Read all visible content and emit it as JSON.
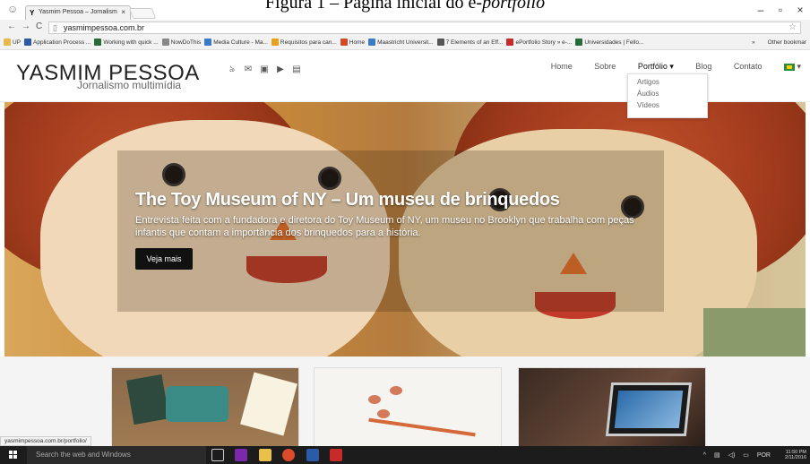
{
  "caption": {
    "text": "Figura 1 – Página inicial do e-",
    "italic": "portfolio"
  },
  "browser": {
    "tab_title": "Yasmim Pessoa – Jornalism",
    "tab_favicon": "Y",
    "url": "yasmimpessoa.com.br",
    "bookmarks": [
      {
        "label": "UP",
        "color": "#e8b84a"
      },
      {
        "label": "Application Process ...",
        "color": "#2a5aa8"
      },
      {
        "label": "Working with quick ...",
        "color": "#2a6a3a"
      },
      {
        "label": "NowDoThis",
        "color": "#888888"
      },
      {
        "label": "Media Culture - Ma...",
        "color": "#3a7ac8"
      },
      {
        "label": "Requisitos para can...",
        "color": "#e8a020"
      },
      {
        "label": "Home",
        "color": "#d04a2a"
      },
      {
        "label": "Maastricht Universit...",
        "color": "#3a7ac8"
      },
      {
        "label": "7 Elements of an Eff...",
        "color": "#555555"
      },
      {
        "label": "ePortfolio Story » e-...",
        "color": "#c82a2a"
      },
      {
        "label": "Universidades | Fello...",
        "color": "#2a6a3a"
      }
    ],
    "bookmarks_overflow": "»",
    "other_bookmarks": "Other bookmar"
  },
  "site": {
    "logo": "YASMIM PESSOA",
    "logo_sub": "Jornalismo multimídia",
    "social_icons": [
      "rss-icon",
      "mail-icon",
      "instagram-icon",
      "youtube-icon",
      "linkedin-icon"
    ],
    "nav": [
      "Home",
      "Sobre",
      "Portfólio ▾",
      "Blog",
      "Contato"
    ],
    "dropdown": [
      "Artigos",
      "Áudios",
      "Vídeos"
    ]
  },
  "hero": {
    "title": "The Toy Museum of NY – Um museu de brinquedos",
    "text": "Entrevista feita com a fundadora e diretora do Toy Museum of NY, um museu no Brooklyn que trabalha com peças infantis que contam a importância dos brinquedos para a história.",
    "button": "Veja mais"
  },
  "status_url": "yasmimpessoa.com.br/portfolio/",
  "taskbar": {
    "search_placeholder": "Search the web and Windows",
    "lang": "POR",
    "time": "11:50 PM",
    "date": "2/11/2016"
  }
}
